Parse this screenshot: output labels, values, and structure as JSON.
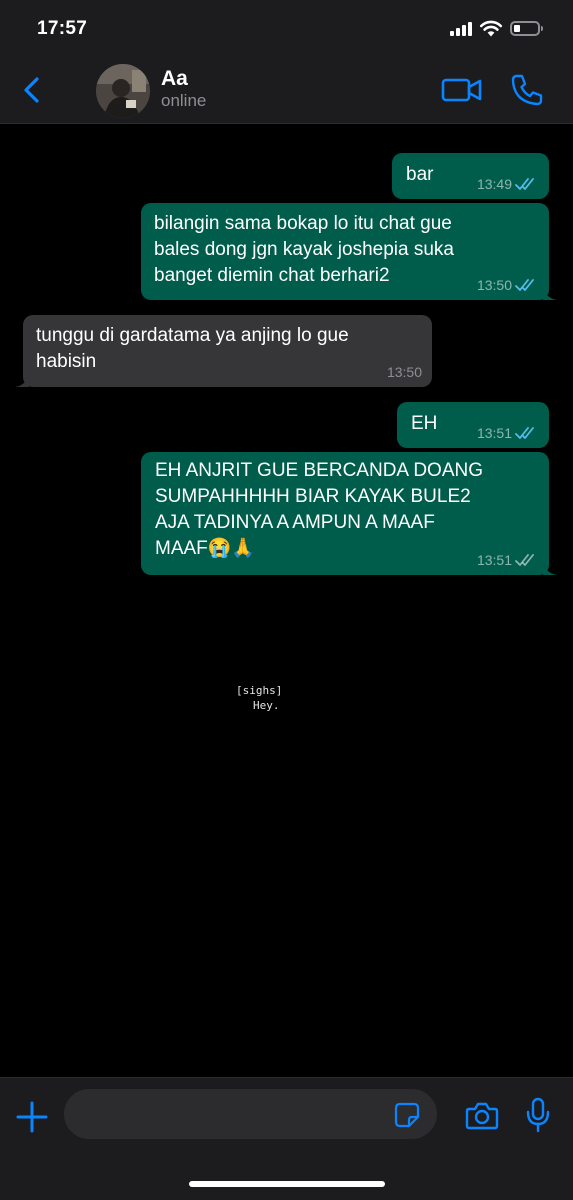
{
  "status_bar": {
    "time": "17:57"
  },
  "header": {
    "contact_name": "Aa",
    "contact_status": "online"
  },
  "messages": [
    {
      "direction": "out",
      "text": "bar",
      "time": "13:49",
      "read": true
    },
    {
      "direction": "out",
      "text": "bilangin sama bokap lo itu chat gue\nbales dong jgn kayak joshepia suka\nbanget diemin chat berhari2",
      "time": "13:50",
      "read": true
    },
    {
      "direction": "in",
      "text": "tunggu di gardatama ya anjing lo gue\nhabisin",
      "time": "13:50"
    },
    {
      "direction": "out",
      "text": "EH",
      "time": "13:51",
      "read": true
    },
    {
      "direction": "out",
      "text": "EH ANJRIT GUE BERCANDA DOANG\nSUMPAHHHHH BIAR KAYAK BULE2\nAJA TADINYA A AMPUN A MAAF\nMAAF😭🙏",
      "time": "13:51",
      "read": false
    }
  ],
  "overlay_caption": {
    "line1": "[sighs]",
    "line2": "Hey."
  },
  "input_bar": {
    "placeholder": ""
  },
  "colors": {
    "outgoing_bubble": "#005c4b",
    "incoming_bubble": "#363638",
    "accent": "#0a84ff",
    "read_tick": "#53bdeb"
  },
  "icons": {
    "back": "chevron-left-icon",
    "video": "video-camera-icon",
    "call": "phone-icon",
    "add": "plus-icon",
    "sticker": "sticker-icon",
    "camera": "camera-icon",
    "mic": "microphone-icon"
  }
}
